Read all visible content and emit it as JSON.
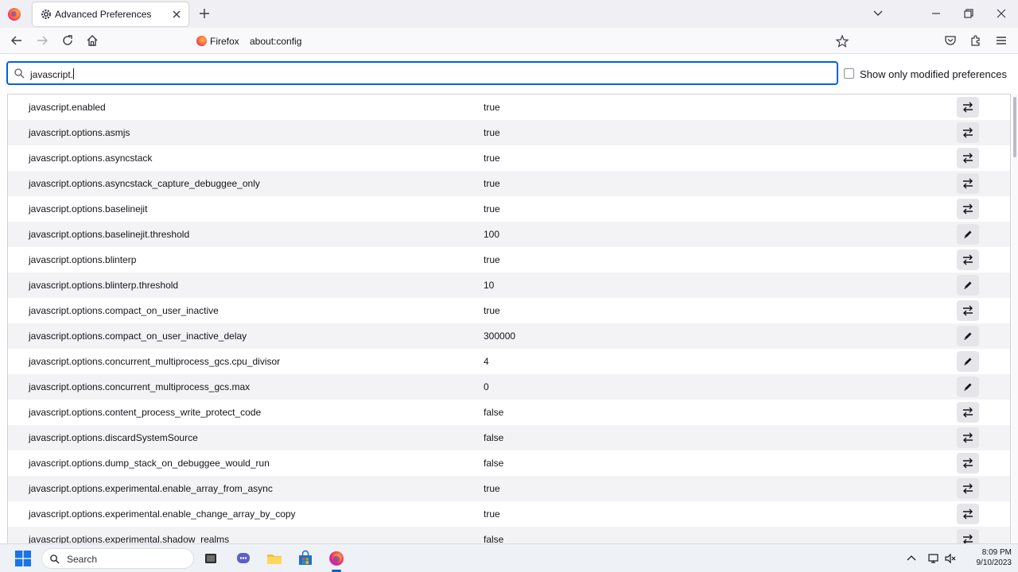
{
  "browser": {
    "tab_title": "Advanced Preferences",
    "url_identity_label": "Firefox",
    "url": "about:config"
  },
  "search": {
    "value": "javascript.",
    "show_modified_label": "Show only modified preferences",
    "show_modified_checked": false
  },
  "prefs": [
    {
      "name": "javascript.enabled",
      "value": "true",
      "action": "toggle-icon"
    },
    {
      "name": "javascript.options.asmjs",
      "value": "true",
      "action": "toggle-icon"
    },
    {
      "name": "javascript.options.asyncstack",
      "value": "true",
      "action": "toggle-icon"
    },
    {
      "name": "javascript.options.asyncstack_capture_debuggee_only",
      "value": "true",
      "action": "toggle-icon"
    },
    {
      "name": "javascript.options.baselinejit",
      "value": "true",
      "action": "toggle-icon"
    },
    {
      "name": "javascript.options.baselinejit.threshold",
      "value": "100",
      "action": "edit-icon"
    },
    {
      "name": "javascript.options.blinterp",
      "value": "true",
      "action": "toggle-icon"
    },
    {
      "name": "javascript.options.blinterp.threshold",
      "value": "10",
      "action": "edit-icon"
    },
    {
      "name": "javascript.options.compact_on_user_inactive",
      "value": "true",
      "action": "toggle-icon"
    },
    {
      "name": "javascript.options.compact_on_user_inactive_delay",
      "value": "300000",
      "action": "edit-icon"
    },
    {
      "name": "javascript.options.concurrent_multiprocess_gcs.cpu_divisor",
      "value": "4",
      "action": "edit-icon"
    },
    {
      "name": "javascript.options.concurrent_multiprocess_gcs.max",
      "value": "0",
      "action": "edit-icon"
    },
    {
      "name": "javascript.options.content_process_write_protect_code",
      "value": "false",
      "action": "toggle-icon"
    },
    {
      "name": "javascript.options.discardSystemSource",
      "value": "false",
      "action": "toggle-icon"
    },
    {
      "name": "javascript.options.dump_stack_on_debuggee_would_run",
      "value": "false",
      "action": "toggle-icon"
    },
    {
      "name": "javascript.options.experimental.enable_array_from_async",
      "value": "true",
      "action": "toggle-icon"
    },
    {
      "name": "javascript.options.experimental.enable_change_array_by_copy",
      "value": "true",
      "action": "toggle-icon"
    },
    {
      "name": "javascript.options.experimental.shadow_realms",
      "value": "false",
      "action": "toggle-icon"
    }
  ],
  "taskbar": {
    "search_placeholder": "Search",
    "time": "8:09 PM",
    "date": "9/10/2023"
  },
  "colors": {
    "accent": "#0061e0",
    "row_alt": "#f3f3f6",
    "toolbar": "#f9f9fb"
  }
}
